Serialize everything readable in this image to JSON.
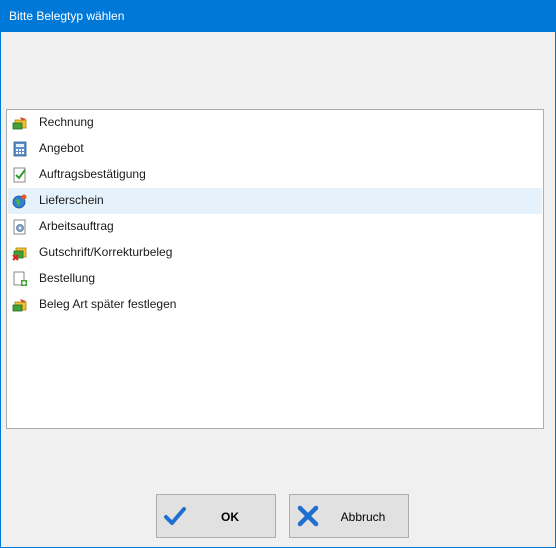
{
  "window": {
    "title": "Bitte Belegtyp wählen"
  },
  "list": {
    "items": [
      {
        "label": "Rechnung",
        "icon": "invoice-icon"
      },
      {
        "label": "Angebot",
        "icon": "calculator-icon"
      },
      {
        "label": "Auftragsbestätigung",
        "icon": "checkmark-document-icon"
      },
      {
        "label": "Lieferschein",
        "icon": "globe-delivery-icon",
        "selected": true
      },
      {
        "label": "Arbeitsauftrag",
        "icon": "gear-document-icon"
      },
      {
        "label": "Gutschrift/Korrekturbeleg",
        "icon": "credit-note-icon"
      },
      {
        "label": "Bestellung",
        "icon": "add-document-icon"
      },
      {
        "label": "Beleg Art später festlegen",
        "icon": "invoice-icon"
      }
    ]
  },
  "buttons": {
    "ok_label": "OK",
    "cancel_label": "Abbruch"
  },
  "colors": {
    "titlebar": "#0078d7",
    "selection": "#e5f1fb",
    "ok_check": "#1f6fd1",
    "cancel_x": "#1f6fd1"
  }
}
